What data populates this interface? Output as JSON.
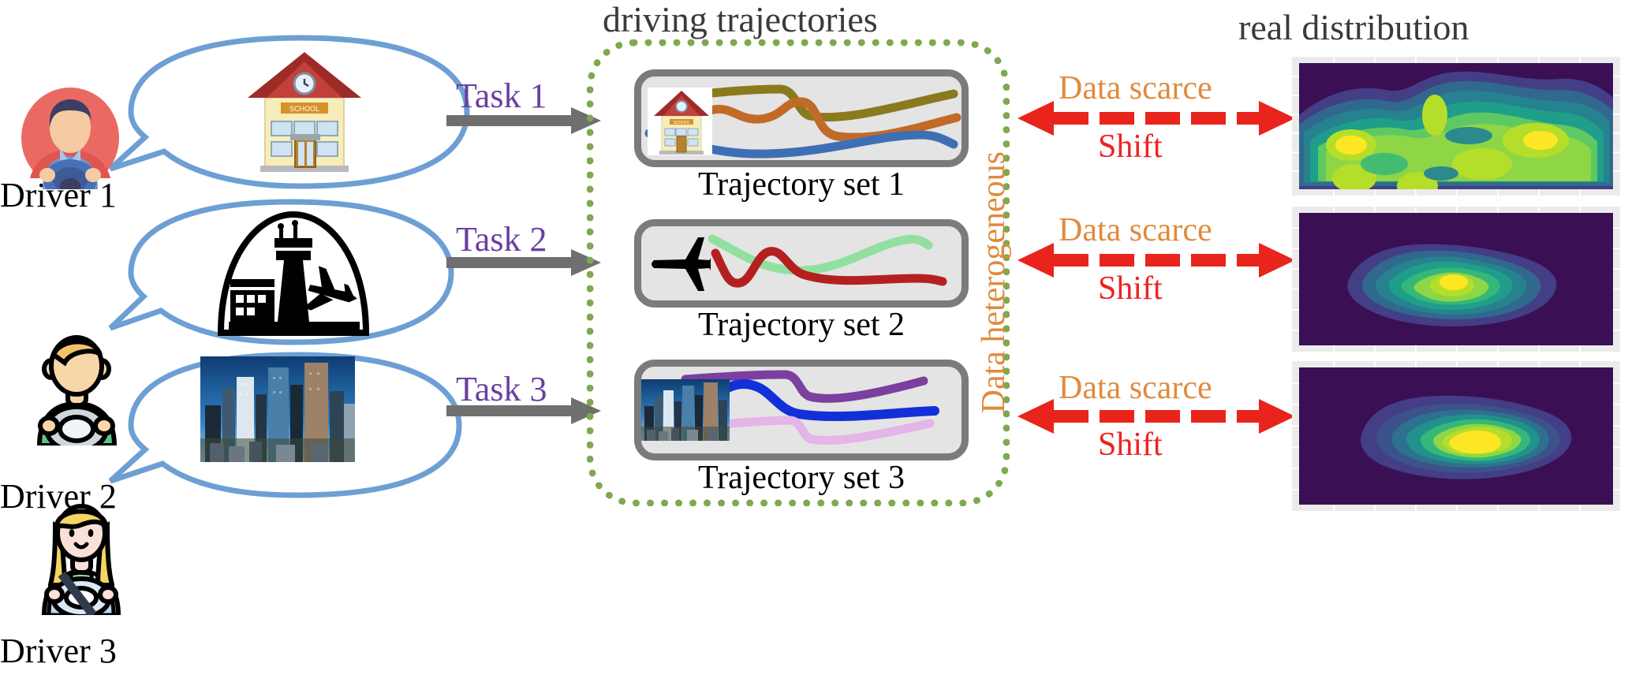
{
  "titles": {
    "driving_trajectories": "driving trajectories",
    "real_distribution": "real distribution"
  },
  "drivers": [
    {
      "label": "Driver 1",
      "avatar_icon": "driver-avatar-male-red",
      "thought_icon": "school-building-icon",
      "task_label": "Task 1"
    },
    {
      "label": "Driver 2",
      "avatar_icon": "driver-avatar-male-green",
      "thought_icon": "airport-control-tower-airplane-icon",
      "task_label": "Task 2"
    },
    {
      "label": "Driver 3",
      "avatar_icon": "driver-avatar-female-blonde",
      "thought_icon": "city-skyline-photo",
      "task_label": "Task 3"
    }
  ],
  "trajectory_sets": [
    {
      "caption": "Trajectory set 1",
      "thumb_icon": "school-building-icon",
      "curves": [
        {
          "name": "curve-olive",
          "color": "#8a7a1e"
        },
        {
          "name": "curve-orange",
          "color": "#c26a28"
        },
        {
          "name": "curve-blue",
          "color": "#3d6fb5"
        }
      ]
    },
    {
      "caption": "Trajectory set 2",
      "thumb_icon": "airplane-icon",
      "curves": [
        {
          "name": "curve-light-green",
          "color": "#92e0a0"
        },
        {
          "name": "curve-dark-red",
          "color": "#b42020"
        }
      ]
    },
    {
      "caption": "Trajectory set 3",
      "thumb_icon": "city-skyline-photo",
      "curves": [
        {
          "name": "curve-purple",
          "color": "#7b3fa0"
        },
        {
          "name": "curve-blue",
          "color": "#1230d8"
        },
        {
          "name": "curve-light-pink",
          "color": "#e3b5e8"
        }
      ]
    }
  ],
  "annotations": {
    "data_heterogeneous": "Data heterogeneous",
    "rows": [
      {
        "scarce": "Data scarce",
        "shift": "Shift"
      },
      {
        "scarce": "Data scarce",
        "shift": "Shift"
      },
      {
        "scarce": "Data scarce",
        "shift": "Shift"
      }
    ]
  },
  "colors": {
    "task_purple": "#6b3fa0",
    "scarce_orange": "#e08a3c",
    "shift_red": "#ee2222",
    "arrow_red": "#e8241c",
    "arrow_gray": "#6f6f6f",
    "dotted_green": "#7fa84f",
    "bubble_blue": "#6d9fd4",
    "panel_border": "#7b7b7b",
    "panel_fill": "#e4e4e4",
    "heading_gray": "#3a3a3a"
  },
  "chart_data": [
    {
      "type": "heatmap",
      "name": "real-distribution-1",
      "colormap": "viridis",
      "title": "real distribution",
      "grid": true,
      "peaks": [
        {
          "x": 0.2,
          "y": 0.48,
          "level": 1.0
        },
        {
          "x": 0.78,
          "y": 0.46,
          "level": 1.0
        },
        {
          "x": 0.2,
          "y": 0.72,
          "level": 0.8
        },
        {
          "x": 0.45,
          "y": 0.3,
          "level": 0.78
        },
        {
          "x": 0.6,
          "y": 0.62,
          "level": 0.82
        },
        {
          "x": 0.42,
          "y": 0.88,
          "level": 0.78
        }
      ],
      "levels": [
        0,
        0.15,
        0.3,
        0.45,
        0.6,
        0.75,
        0.9,
        1.0
      ],
      "description": "multi-modal broad high-density distribution spanning most of the field"
    },
    {
      "type": "heatmap",
      "name": "real-distribution-2",
      "colormap": "viridis",
      "grid": true,
      "peaks": [
        {
          "x": 0.52,
          "y": 0.5,
          "level": 1.0
        }
      ],
      "levels": [
        0,
        0.15,
        0.3,
        0.45,
        0.6,
        0.75,
        0.9,
        1.0
      ],
      "description": "single compact unimodal peak, narrow support, mostly dark background"
    },
    {
      "type": "heatmap",
      "name": "real-distribution-3",
      "colormap": "viridis",
      "grid": true,
      "peaks": [
        {
          "x": 0.5,
          "y": 0.48,
          "level": 1.0
        }
      ],
      "levels": [
        0,
        0.15,
        0.3,
        0.45,
        0.6,
        0.75,
        0.9,
        1.0
      ],
      "description": "single broad unimodal peak with large yellow core, dark background"
    }
  ]
}
